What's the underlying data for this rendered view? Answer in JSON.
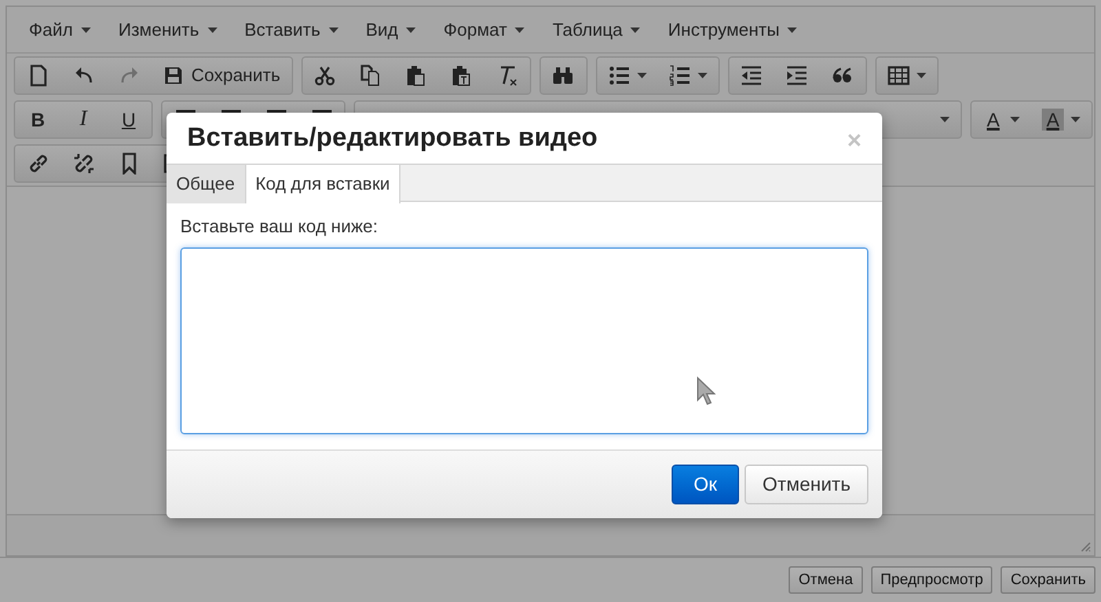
{
  "menu": [
    {
      "label": "Файл"
    },
    {
      "label": "Изменить"
    },
    {
      "label": "Вставить"
    },
    {
      "label": "Вид"
    },
    {
      "label": "Формат"
    },
    {
      "label": "Таблица"
    },
    {
      "label": "Инструменты"
    }
  ],
  "toolbar_rows": [
    [
      {
        "items": [
          {
            "kind": "icon",
            "disabled": false
          },
          {
            "kind": "icon",
            "disabled": false
          },
          {
            "kind": "icon",
            "disabled": true
          },
          {
            "kind": "icon_text",
            "label": "Сохранить",
            "disabled": false
          }
        ]
      },
      {
        "items": [
          {
            "kind": "icon",
            "disabled": false
          },
          {
            "kind": "icon",
            "disabled": false
          },
          {
            "kind": "icon",
            "disabled": false
          },
          {
            "kind": "icon",
            "disabled": false
          },
          {
            "kind": "icon",
            "disabled": false
          }
        ]
      },
      {
        "items": [
          {
            "kind": "icon",
            "disabled": false
          }
        ]
      },
      {
        "items": [
          {
            "kind": "icon",
            "disabled": false,
            "dropdown": true
          },
          {
            "kind": "icon",
            "disabled": false,
            "dropdown": true
          }
        ]
      },
      {
        "items": [
          {
            "kind": "icon",
            "disabled": false
          },
          {
            "kind": "icon",
            "disabled": false
          },
          {
            "kind": "icon",
            "disabled": false
          }
        ]
      },
      {
        "items": [
          {
            "kind": "icon",
            "disabled": false,
            "dropdown": true
          }
        ]
      }
    ],
    [
      {
        "items": [
          {
            "kind": "letter",
            "label": "B",
            "disabled": false
          },
          {
            "kind": "letter",
            "label": "I",
            "disabled": false
          },
          {
            "kind": "letter",
            "label": "U",
            "disabled": false
          }
        ]
      },
      {
        "items": [
          {
            "kind": "icon",
            "disabled": false
          },
          {
            "kind": "icon",
            "disabled": false
          },
          {
            "kind": "icon",
            "disabled": false
          },
          {
            "kind": "icon",
            "disabled": false
          }
        ]
      },
      {
        "items": [
          {
            "kind": "select",
            "disabled": false,
            "dropdown": true
          }
        ]
      },
      {
        "items": [
          {
            "kind": "letter",
            "label": "A",
            "disabled": false,
            "dropdown": true
          },
          {
            "kind": "letter",
            "label": "A",
            "disabled": false,
            "dropdown": true,
            "highlight": true
          }
        ]
      }
    ],
    [
      {
        "items": [
          {
            "kind": "icon",
            "disabled": false
          },
          {
            "kind": "icon",
            "disabled": false
          },
          {
            "kind": "icon",
            "disabled": false
          },
          {
            "kind": "icon",
            "disabled": false
          }
        ]
      }
    ]
  ],
  "dialog": {
    "title": "Вставить/редактировать видео",
    "close": "×",
    "tabs": [
      {
        "label": "Общее",
        "selected": false
      },
      {
        "label": "Код для вставки",
        "selected": true
      }
    ],
    "field_label": "Вставьте ваш код ниже:",
    "buttons": [
      {
        "label": "Ок",
        "kind": "primary"
      },
      {
        "label": "Отменить",
        "kind": "secondary"
      }
    ]
  },
  "footer_buttons": [
    {
      "label": "Отмена"
    },
    {
      "label": "Предпросмотр"
    },
    {
      "label": "Сохранить"
    }
  ]
}
